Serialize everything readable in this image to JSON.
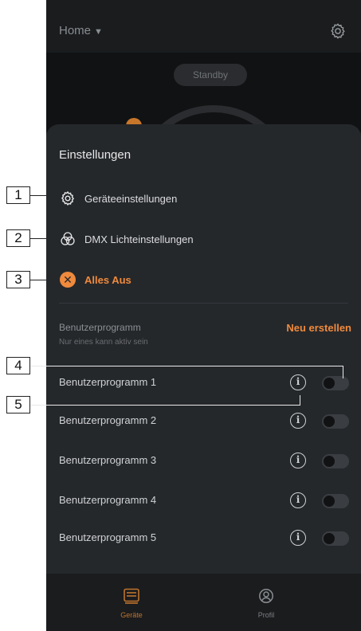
{
  "callouts": [
    "1",
    "2",
    "3",
    "4",
    "5"
  ],
  "header": {
    "title": "Home",
    "caret": "▼"
  },
  "stage": {
    "standby_label": "Standby"
  },
  "sheet": {
    "title": "Einstellungen",
    "menu": [
      {
        "label": "Geräteeinstellungen",
        "icon": "gear-icon"
      },
      {
        "label": "DMX Lichteinstellungen",
        "icon": "rgb-circles-icon"
      },
      {
        "label": "Alles Aus",
        "icon": "close-circle-icon"
      }
    ]
  },
  "programs": {
    "header": "Benutzerprogramm",
    "subheader": "Nur eines kann aktiv sein",
    "new_label": "Neu erstellen",
    "items": [
      {
        "name": "Benutzerprogramm 1",
        "active": false
      },
      {
        "name": "Benutzerprogramm 2",
        "active": false
      },
      {
        "name": "Benutzerprogramm 3",
        "active": false
      },
      {
        "name": "Benutzerprogramm 4",
        "active": false
      },
      {
        "name": "Benutzerprogramm 5",
        "active": false
      }
    ]
  },
  "tabs": [
    {
      "label": "Geräte",
      "icon": "device-icon",
      "active": true
    },
    {
      "label": "Profil",
      "icon": "profile-icon",
      "active": false
    }
  ],
  "colors": {
    "accent": "#f08a3c",
    "background": "#25282b",
    "topbar": "#1a1c1e"
  }
}
